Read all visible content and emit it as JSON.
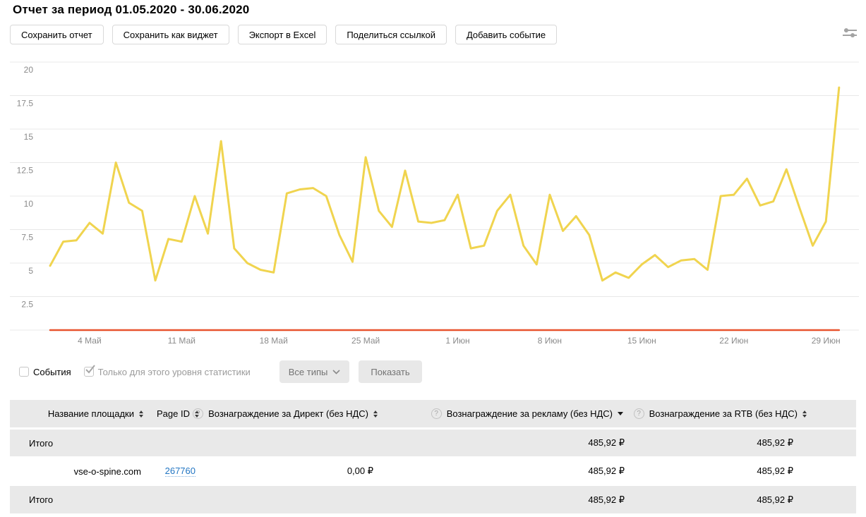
{
  "title": "Отчет за период 01.05.2020 - 30.06.2020",
  "toolbar": {
    "buttons": [
      "Сохранить отчет",
      "Сохранить как виджет",
      "Экспорт в Excel",
      "Поделиться ссылкой",
      "Добавить событие"
    ]
  },
  "chart_data": {
    "type": "line",
    "title": "",
    "xlabel": "",
    "ylabel": "",
    "date_range": "01.05.2020 - 30.06.2020",
    "num_points": 61,
    "ylim": [
      0,
      21.3
    ],
    "grid": true,
    "legend_position": "none",
    "y_ticks": [
      2.5,
      5,
      7.5,
      10,
      12.5,
      15,
      17.5,
      20
    ],
    "y_gridlines": [
      0,
      2.5,
      5,
      7.5,
      10,
      12.5,
      15,
      17.5,
      20
    ],
    "x_ticks": [
      {
        "day_index": 3,
        "label": "4 Май"
      },
      {
        "day_index": 10,
        "label": "11 Май"
      },
      {
        "day_index": 17,
        "label": "18 Май"
      },
      {
        "day_index": 24,
        "label": "25 Май"
      },
      {
        "day_index": 31,
        "label": "1 Июн"
      },
      {
        "day_index": 38,
        "label": "8 Июн"
      },
      {
        "day_index": 45,
        "label": "15 Июн"
      },
      {
        "day_index": 52,
        "label": "22 Июн"
      },
      {
        "day_index": 59,
        "label": "29 Июн"
      }
    ],
    "series": [
      {
        "name": "yellow-line",
        "color": "#f0d44f",
        "values": [
          4.8,
          6.6,
          6.7,
          8.0,
          7.2,
          12.5,
          9.5,
          8.9,
          3.7,
          6.8,
          6.6,
          10.0,
          7.2,
          14.1,
          6.1,
          5.0,
          4.5,
          4.3,
          10.2,
          10.5,
          10.6,
          10.0,
          7.1,
          5.1,
          12.9,
          8.9,
          7.7,
          11.9,
          8.1,
          8.0,
          8.2,
          10.1,
          6.1,
          6.3,
          8.9,
          10.1,
          6.3,
          4.9,
          10.1,
          7.4,
          8.5,
          7.1,
          3.7,
          4.3,
          3.9,
          4.9,
          5.6,
          4.7,
          5.2,
          5.3,
          4.5,
          10.0,
          10.1,
          11.3,
          9.3,
          9.6,
          12.0,
          9.1,
          6.3,
          8.1,
          18.1
        ]
      },
      {
        "name": "orange-flat-line",
        "color": "#e8542e",
        "constant": 0,
        "points": 61
      }
    ]
  },
  "events_bar": {
    "events_label": "События",
    "events_checked": false,
    "scope_label": "Только для этого уровня статистики",
    "scope_checked": true,
    "type_filter_label": "Все типы",
    "show_button_label": "Показать"
  },
  "table": {
    "columns": [
      {
        "label": "Название площадки",
        "sort": "both",
        "help": false
      },
      {
        "label": "Page ID",
        "sort": "both",
        "help": false
      },
      {
        "label": "Вознаграждение за Директ (без НДС)",
        "sort": "both",
        "help": true
      },
      {
        "label": "Вознаграждение за рекламу (без НДС)",
        "sort": "desc",
        "help": true
      },
      {
        "label": "Вознаграждение за RTB (без НДС)",
        "sort": "both",
        "help": true
      }
    ],
    "rows": [
      {
        "type": "total",
        "cells": [
          "Итого",
          "",
          "",
          "485,92 ₽",
          "485,92 ₽"
        ]
      },
      {
        "type": "data",
        "cells": [
          "vse-o-spine.com",
          "267760",
          "0,00 ₽",
          "485,92 ₽",
          "485,92 ₽"
        ],
        "link_col": 1
      },
      {
        "type": "total",
        "cells": [
          "Итого",
          "",
          "",
          "485,92 ₽",
          "485,92 ₽"
        ]
      }
    ]
  },
  "colors": {
    "accent_yellow": "#f0d44f",
    "accent_orange": "#e8542e",
    "link_blue": "#2276c3",
    "gridline": "#e8e8e8",
    "axis_label": "#8a8a8a",
    "table_gray_bg": "#e9e9e9",
    "gray_button_bg": "#e8e8e8",
    "gray_button_text": "#737373"
  }
}
